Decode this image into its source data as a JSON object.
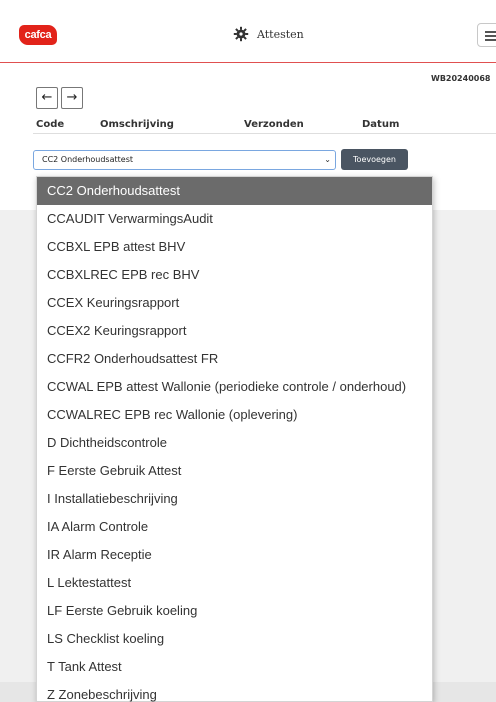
{
  "header": {
    "logo_text": "cafca",
    "title": "Attesten",
    "title_icon": "gear-icon",
    "menu_icon": "hamburger-icon",
    "brand_color": "#e2231a"
  },
  "document": {
    "id": "WB20240068"
  },
  "navigation": {
    "back_icon": "arrow-left-icon",
    "back_glyph": "←",
    "forward_icon": "arrow-right-icon",
    "forward_glyph": "→"
  },
  "table": {
    "columns": [
      "Code",
      "Omschrijving",
      "Verzonden",
      "Datum"
    ]
  },
  "form": {
    "selected_option": "CC2 Onderhoudsattest",
    "chevron_glyph": "⌄",
    "add_label": "Toevoegen"
  },
  "dropdown": {
    "options": [
      "CC2 Onderhoudsattest",
      "CCAUDIT VerwarmingsAudit",
      "CCBXL EPB attest BHV",
      "CCBXLREC EPB rec BHV",
      "CCEX Keuringsrapport",
      "CCEX2 Keuringsrapport",
      "CCFR2 Onderhoudsattest FR",
      "CCWAL EPB attest Wallonie (periodieke controle / onderhoud)",
      "CCWALREC EPB rec Wallonie (oplevering)",
      "D Dichtheidscontrole",
      "F Eerste Gebruik Attest",
      "I Installatiebeschrijving",
      "IA Alarm Controle",
      "IR Alarm Receptie",
      "L Lektestattest",
      "LF Eerste Gebruik koeling",
      "LS Checklist koeling",
      "T Tank Attest",
      "Z Zonebeschrijving"
    ],
    "selected_index": 0
  }
}
